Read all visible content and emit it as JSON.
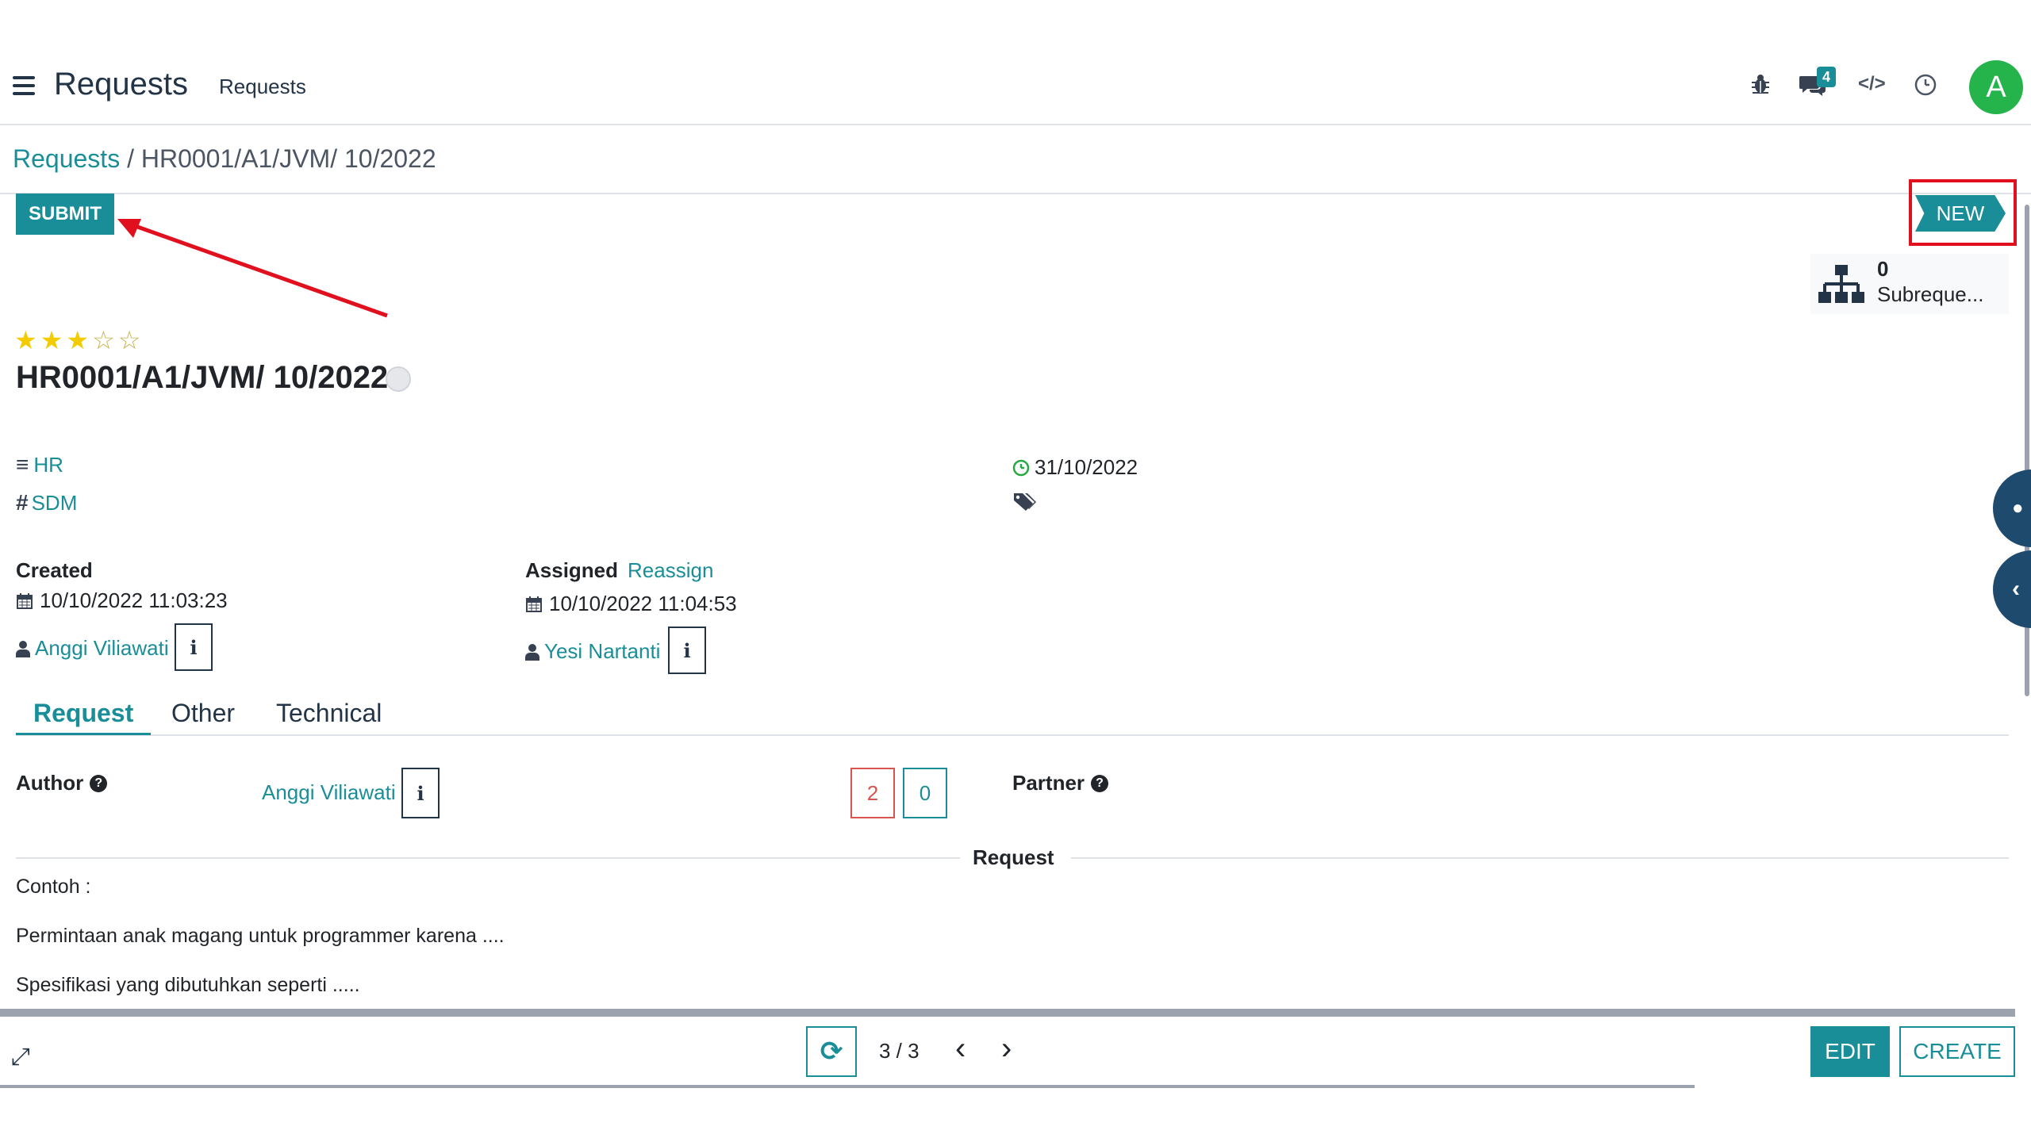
{
  "header": {
    "app_title": "Requests",
    "menu_item": "Requests",
    "chat_badge": "4",
    "avatar_initial": "A"
  },
  "breadcrumb": {
    "parent": "Requests",
    "separator": " / ",
    "current": "HR0001/A1/JVM/ 10/2022"
  },
  "statusbar": {
    "submit_label": "SUBMIT",
    "stage_label": "NEW"
  },
  "smart_buttons": {
    "subrequests_count": "0",
    "subrequests_label": "Subreque..."
  },
  "record": {
    "priority": 3,
    "title": "HR0001/A1/JVM/ 10/2022",
    "service": "HR",
    "category": "SDM",
    "deadline": "31/10/2022"
  },
  "created": {
    "label": "Created",
    "date": "10/10/2022 11:03:23",
    "user": "Anggi Viliawati"
  },
  "assigned": {
    "label": "Assigned",
    "action": "Reassign",
    "date": "10/10/2022 11:04:53",
    "user": "Yesi Nartanti"
  },
  "info_glyph": "i",
  "tabs": [
    {
      "label": "Request"
    },
    {
      "label": "Other"
    },
    {
      "label": "Technical"
    }
  ],
  "request_tab": {
    "author_label": "Author",
    "author_value": "Anggi Viliawati",
    "count_red": "2",
    "count_teal": "0",
    "partner_label": "Partner",
    "separator_label": "Request",
    "body_lines": [
      "Contoh :",
      "Permintaan anak magang untuk programmer karena ....",
      "Spesifikasi yang dibutuhkan seperti ....."
    ]
  },
  "pager": {
    "value": "3 / 3"
  },
  "actions": {
    "edit_label": "EDIT",
    "create_label": "CREATE"
  },
  "colors": {
    "accent": "#1a8e98",
    "highlight": "#e0101f",
    "avatar": "#25b34b"
  }
}
